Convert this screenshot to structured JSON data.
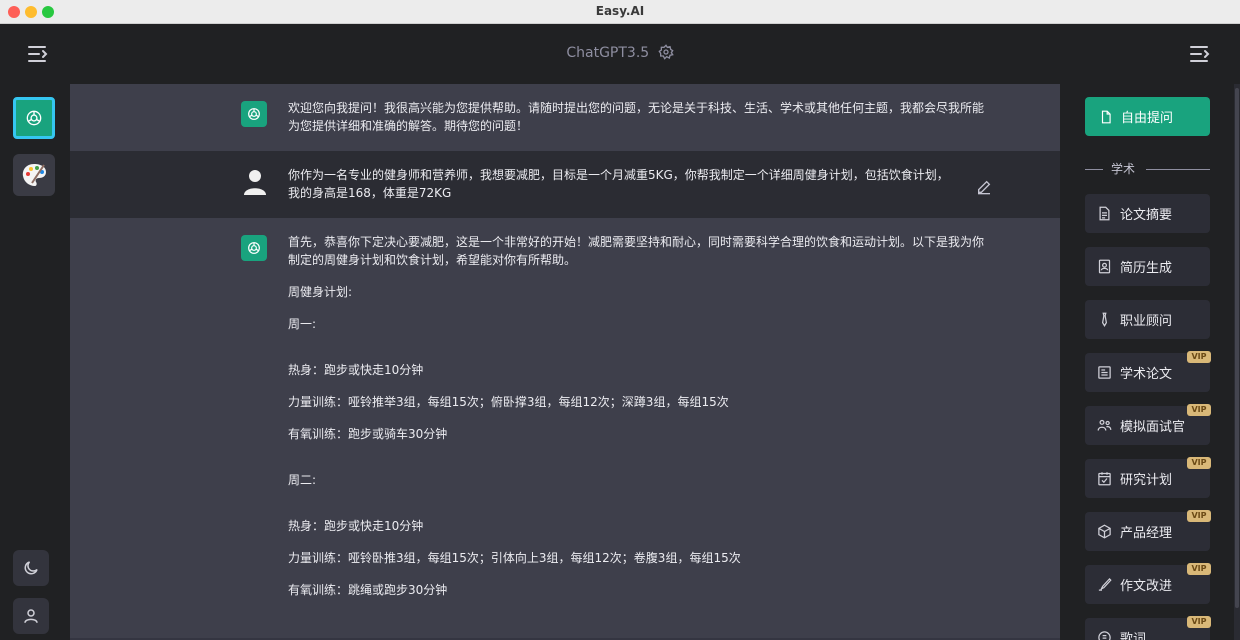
{
  "window": {
    "title": "Easy.AI"
  },
  "header": {
    "model_name": "ChatGPT3.5"
  },
  "messages": {
    "ai_greeting": {
      "lines": [
        "欢迎您向我提问！我很高兴能为您提供帮助。请随时提出您的问题，无论是关于科技、生活、学术或其他任何主题，我都会尽我所能",
        "为您提供详细和准确的解答。期待您的问题！"
      ]
    },
    "user_question": {
      "lines": [
        "你作为一名专业的健身师和营养师，我想要减肥，目标是一个月减重5KG，你帮我制定一个详细周健身计划，包括饮食计划，",
        "我的身高是168，体重是72KG"
      ]
    },
    "ai_answer": {
      "intro": [
        "首先，恭喜你下定决心要减肥，这是一个非常好的开始！减肥需要坚持和耐心，同时需要科学合理的饮食和运动计划。以下是我为你",
        "制定的周健身计划和饮食计划，希望能对你有所帮助。"
      ],
      "plan_title": "周健身计划:",
      "day1": "周一:",
      "day1_warmup": "热身：跑步或快走10分钟",
      "day1_strength": "力量训练：哑铃推举3组，每组15次；俯卧撑3组，每组12次；深蹲3组，每组15次",
      "day1_cardio": "有氧训练：跑步或骑车30分钟",
      "day2": "周二:",
      "day2_warmup": "热身：跑步或快走10分钟",
      "day2_strength": "力量训练：哑铃卧推3组，每组15次；引体向上3组，每组12次；卷腹3组，每组15次",
      "day2_cardio": "有氧训练：跳绳或跑步30分钟"
    }
  },
  "right_panel": {
    "primary_button": "自由提问",
    "section_label": "学术",
    "vip_badge": "VIP",
    "items": [
      {
        "label": "论文摘要",
        "vip": false,
        "icon": "document-icon"
      },
      {
        "label": "简历生成",
        "vip": false,
        "icon": "resume-icon"
      },
      {
        "label": "职业顾问",
        "vip": false,
        "icon": "tie-icon"
      },
      {
        "label": "学术论文",
        "vip": true,
        "icon": "paper-icon"
      },
      {
        "label": "模拟面试官",
        "vip": true,
        "icon": "interview-icon"
      },
      {
        "label": "研究计划",
        "vip": true,
        "icon": "calendar-icon"
      },
      {
        "label": "产品经理",
        "vip": true,
        "icon": "cube-icon"
      },
      {
        "label": "作文改进",
        "vip": true,
        "icon": "pen-icon"
      },
      {
        "label": "歌词",
        "vip": true,
        "icon": "lyrics-icon"
      }
    ]
  },
  "colors": {
    "accent": "#19a37e",
    "chat_bg": "#343541",
    "sidebar_bg": "#202123",
    "vip_gold": "#d9b878"
  }
}
